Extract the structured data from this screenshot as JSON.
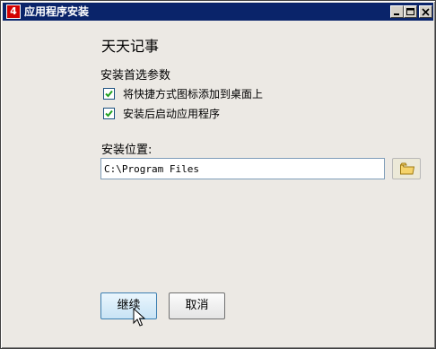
{
  "window": {
    "title": "应用程序安装",
    "icon_text": "4"
  },
  "app": {
    "name": "天天记事"
  },
  "preferences": {
    "title": "安装首选参数",
    "options": [
      {
        "label": "将快捷方式图标添加到桌面上",
        "checked": true
      },
      {
        "label": "安装后启动应用程序",
        "checked": true
      }
    ]
  },
  "install_location": {
    "label": "安装位置:",
    "path": "C:\\Program Files"
  },
  "buttons": {
    "continue": "继续",
    "cancel": "取消"
  },
  "icons": {
    "browse": "folder-icon",
    "checkmark": "checkmark-icon"
  }
}
